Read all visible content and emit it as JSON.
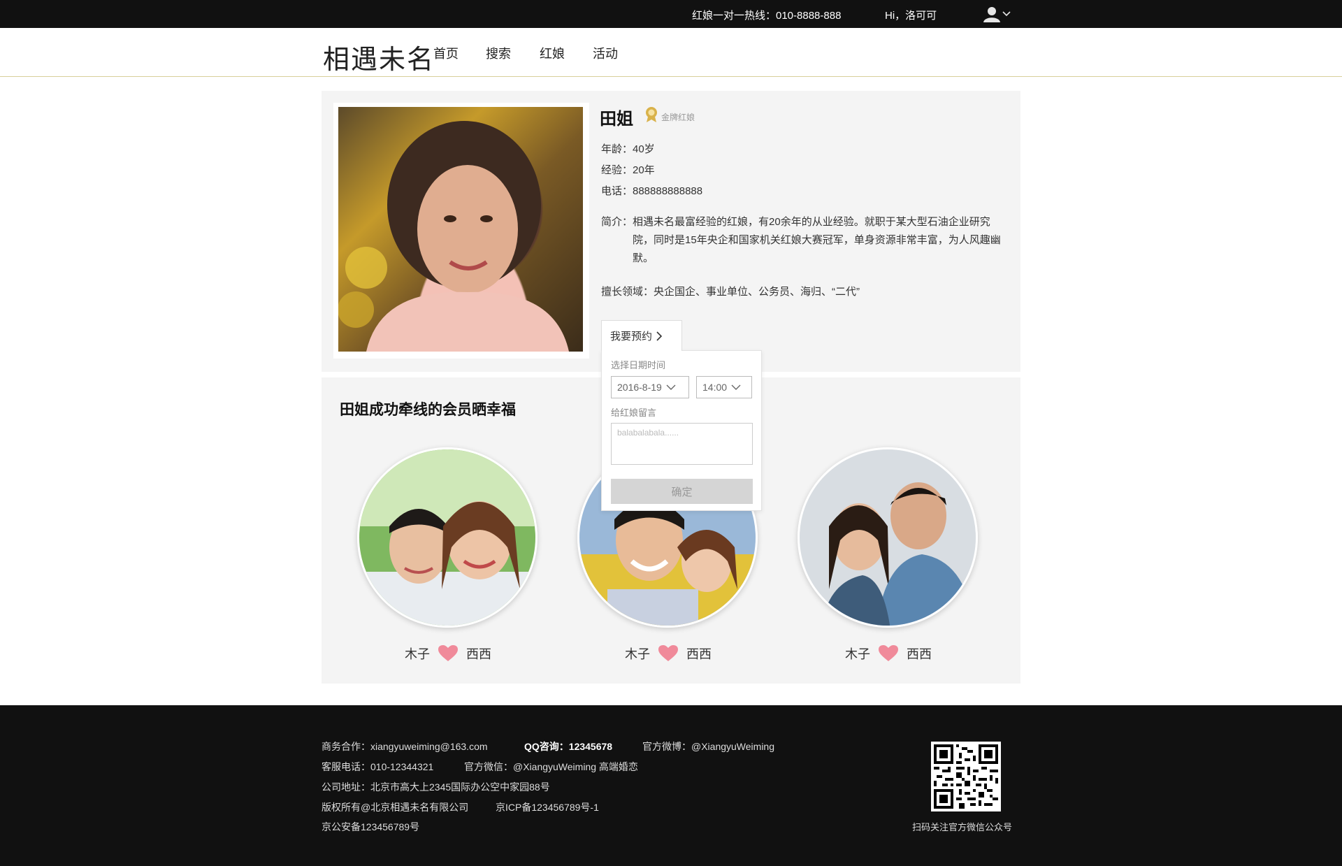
{
  "topbar": {
    "hotline": "红娘一对一热线：010-8888-888",
    "greeting": "Hi，洛可可",
    "user_icon": "user-icon"
  },
  "nav": {
    "logo": "相遇未名",
    "items": [
      {
        "label": "首页"
      },
      {
        "label": "搜索"
      },
      {
        "label": "红娘"
      },
      {
        "label": "活动"
      }
    ]
  },
  "profile": {
    "name": "田姐",
    "badge": "金牌红娘",
    "age": "年龄：40岁",
    "experience": "经验：20年",
    "phone": "电话：888888888888",
    "intro_label": "简介：",
    "intro_text": "相遇未名最富经验的红娘，有20余年的从业经验。就职于某大型石油企业研究院，同时是15年央企和国家机关红娘大赛冠军，单身资源非常丰富，为人风趣幽默。",
    "expertise": "擅长领域：央企国企、事业单位、公务员、海归、“二代”",
    "booking_button": "我要预约"
  },
  "booking": {
    "datetime_label": "选择日期时间",
    "date_value": "2016-8-19",
    "time_value": "14:00",
    "message_label": "给红娘留言",
    "message_placeholder": "balabalabala......",
    "confirm_label": "确定"
  },
  "success": {
    "title": "田姐成功牵线的会员晒幸福",
    "couples": [
      {
        "left": "木子",
        "right": "西西"
      },
      {
        "left": "木子",
        "right": "西西"
      },
      {
        "left": "木子",
        "right": "西西"
      }
    ]
  },
  "footer": {
    "business": "商务合作：xiangyuweiming@163.com",
    "qq": "QQ咨询：12345678",
    "weibo": "官方微博：@XiangyuWeiming",
    "service_phone": "客服电话：010-12344321",
    "wechat": "官方微信：@XiangyuWeiming 高端婚恋",
    "address": "公司地址：北京市高大上2345国际办公空中家园88号",
    "copyright": "版权所有@北京相遇未名有限公司",
    "icp": "京ICP备123456789号-1",
    "police": "京公安备123456789号",
    "qr_caption": "扫码关注官方微信公众号"
  },
  "colors": {
    "topbar_bg": "#111111",
    "panel_bg": "#f4f4f4",
    "heart": "#f08a9a",
    "badge_gold": "#d9b24a"
  }
}
